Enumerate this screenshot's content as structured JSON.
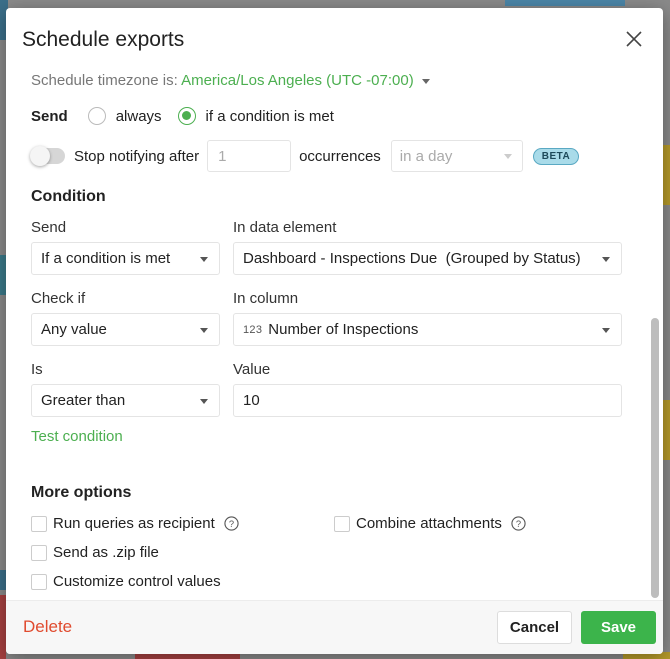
{
  "dialog": {
    "title": "Schedule exports"
  },
  "timezone": {
    "prefix": "Schedule timezone is:",
    "value": "America/Los Angeles (UTC -07:00)"
  },
  "send": {
    "label": "Send",
    "options": [
      {
        "label": "always",
        "selected": false
      },
      {
        "label": "if a condition is met",
        "selected": true
      }
    ]
  },
  "stop_notifying": {
    "label": "Stop notifying after",
    "enabled": false,
    "count_placeholder": "1",
    "occurrences_label": "occurrences",
    "period": "in a day",
    "badge": "BETA"
  },
  "condition": {
    "title": "Condition",
    "send_label": "Send",
    "send_value": "If a condition is met",
    "element_label": "In data element",
    "element_value": "Dashboard - Inspections Due  (Grouped by Status)",
    "check_label": "Check if",
    "check_value": "Any value",
    "column_label": "In column",
    "column_type": "123",
    "column_value": "Number of Inspections",
    "is_label": "Is",
    "is_value": "Greater than",
    "value_label": "Value",
    "value": "10",
    "test_link": "Test condition"
  },
  "more_options": {
    "title": "More options",
    "run_as_recipient": {
      "label": "Run queries as recipient",
      "checked": false
    },
    "combine_attachments": {
      "label": "Combine attachments",
      "checked": false
    },
    "send_zip": {
      "label": "Send as .zip file",
      "checked": false
    },
    "customize_controls": {
      "label": "Customize control values",
      "checked": false
    }
  },
  "footer": {
    "delete_label": "Delete",
    "cancel_label": "Cancel",
    "save_label": "Save"
  },
  "colors": {
    "accent_green": "#4caf50",
    "save_button": "#3cb44b",
    "delete_red": "#e04b2f",
    "beta_badge": "#a9dbe9"
  },
  "icons": [
    "close-icon",
    "chevron-down-icon",
    "help-icon"
  ]
}
